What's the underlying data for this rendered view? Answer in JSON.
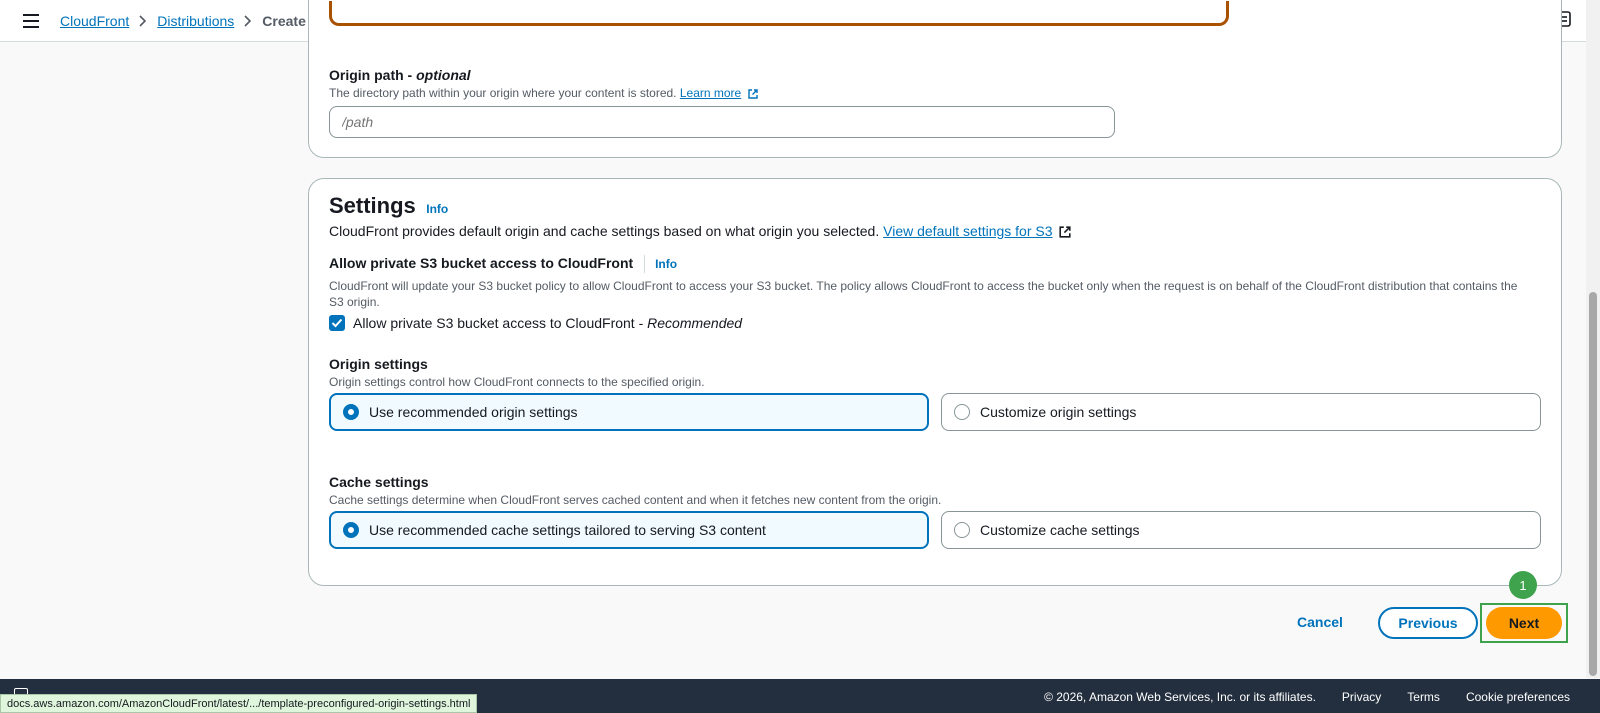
{
  "breadcrumb": {
    "items": [
      {
        "label": "CloudFront"
      },
      {
        "label": "Distributions"
      }
    ],
    "current": "Create distribution"
  },
  "origin_path": {
    "label": "Origin path - ",
    "label_optional": "optional",
    "description": "The directory path within your origin where your content is stored.",
    "learn_more": "Learn more",
    "placeholder": "/path",
    "value": ""
  },
  "settings": {
    "title": "Settings",
    "info": "Info",
    "description": "CloudFront provides default origin and cache settings based on what origin you selected.",
    "view_defaults_link": "View default settings for S3",
    "private_access": {
      "label": "Allow private S3 bucket access to CloudFront",
      "info": "Info",
      "description": "CloudFront will update your S3 bucket policy to allow CloudFront to access your S3 bucket. The policy allows CloudFront to access the bucket only when the request is on behalf of the CloudFront distribution that contains the S3 origin.",
      "checkbox_label": "Allow private S3 bucket access to CloudFront - ",
      "checkbox_recommended": "Recommended",
      "checked": true
    },
    "origin_settings": {
      "label": "Origin settings",
      "description": "Origin settings control how CloudFront connects to the specified origin.",
      "options": [
        {
          "label": "Use recommended origin settings",
          "selected": true
        },
        {
          "label": "Customize origin settings",
          "selected": false
        }
      ]
    },
    "cache_settings": {
      "label": "Cache settings",
      "description": "Cache settings determine when CloudFront serves cached content and when it fetches new content from the origin.",
      "options": [
        {
          "label": "Use recommended cache settings tailored to serving S3 content",
          "selected": true
        },
        {
          "label": "Customize cache settings",
          "selected": false
        }
      ]
    }
  },
  "actions": {
    "cancel": "Cancel",
    "previous": "Previous",
    "next": "Next",
    "step_badge": "1"
  },
  "footer": {
    "copyright": "© 2026, Amazon Web Services, Inc. or its affiliates.",
    "links": [
      "Privacy",
      "Terms",
      "Cookie preferences"
    ]
  },
  "status_bar_url": "docs.aws.amazon.com/AmazonCloudFront/latest/.../template-preconfigured-origin-settings.html",
  "colors": {
    "link": "#0073bb",
    "primary_button": "#ff9900",
    "footer_bg": "#232f3e",
    "highlight_frame": "#3fa34d"
  }
}
